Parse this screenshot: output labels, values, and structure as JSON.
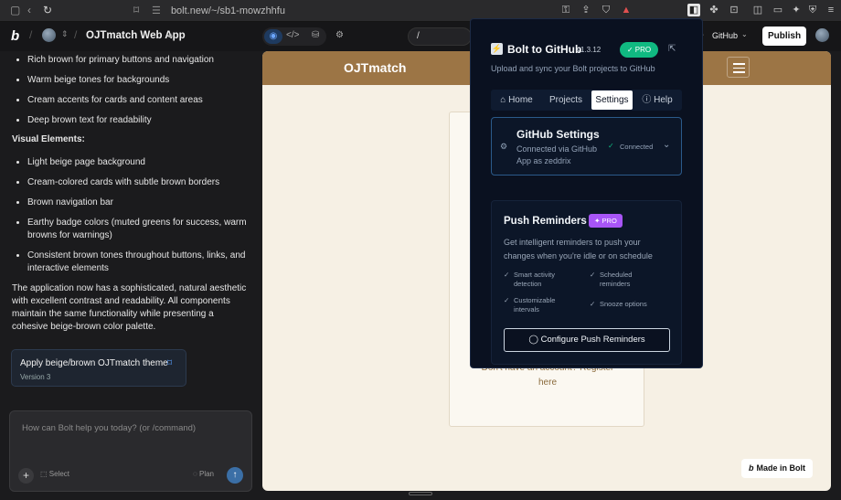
{
  "browser": {
    "url": "bolt.new/~/sb1-mowzhhfu"
  },
  "appbar": {
    "project_name": "OJTmatch Web App",
    "preview_path": "/",
    "github_label": "GitHub",
    "publish_label": "Publish"
  },
  "chat": {
    "bullets_a": [
      "Rich brown for primary buttons and navigation",
      "Warm beige tones for backgrounds",
      "Cream accents for cards and content areas",
      "Deep brown text for readability"
    ],
    "visual_heading": "Visual Elements:",
    "bullets_b": [
      "Light beige page background",
      "Cream-colored cards with subtle brown borders",
      "Brown navigation bar",
      "Earthy badge colors (muted greens for success, warm browns for warnings)",
      "Consistent brown tones throughout buttons, links, and interactive elements"
    ],
    "summary": "The application now has a sophisticated, natural aesthetic with excellent contrast and readability. All components maintain the same functionality while presenting a cohesive beige-brown color palette.",
    "version_card": {
      "title": "Apply beige/brown OJTmatch theme",
      "version": "Version 3"
    },
    "input_placeholder": "How can Bolt help you today? (or /command)",
    "select_label": "Select",
    "plan_label": "Plan"
  },
  "preview": {
    "brand": "OJTmatch",
    "card_text_1": "Don't have an account? Register",
    "card_text_2": "here",
    "made_in_bolt": "Made in Bolt"
  },
  "popup": {
    "title": "Bolt to GitHub",
    "version": "v1.3.12",
    "pro_badge": "PRO",
    "subtitle": "Upload and sync your Bolt projects to GitHub",
    "tabs": [
      "Home",
      "Projects",
      "Settings",
      "Help"
    ],
    "active_tab": "Settings",
    "github_settings": {
      "title": "GitHub Settings",
      "line1": "Connected via GitHub",
      "line2": "App as zeddrix",
      "status": "Connected"
    },
    "push": {
      "title": "Push Reminders",
      "badge": "PRO",
      "desc1": "Get intelligent reminders to push your",
      "desc2": "changes when you're idle or on schedule",
      "features": [
        {
          "l1": "Smart activity",
          "l2": "detection"
        },
        {
          "l1": "Scheduled",
          "l2": "reminders"
        },
        {
          "l1": "Customizable",
          "l2": "intervals"
        },
        {
          "l1": "Snooze options",
          "l2": ""
        }
      ],
      "button": "Configure Push Reminders"
    }
  },
  "colors": {
    "brown": "#9c7545",
    "beige": "#f6f0e4",
    "popup_bg": "#0a1120",
    "pro_green": "#10b981",
    "pro_purple": "#a855f7"
  }
}
